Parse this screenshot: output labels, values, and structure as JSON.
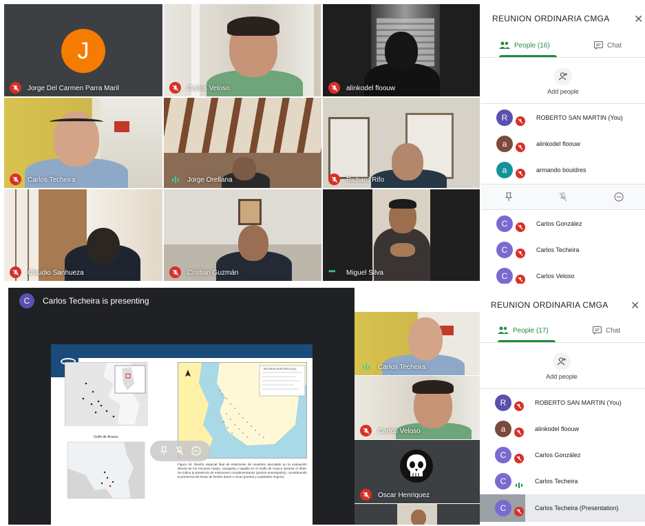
{
  "top": {
    "tiles": [
      {
        "name": "Jorge Del Carmen Parra Maril",
        "initial": "J"
      },
      {
        "name": "Carlos Veloso"
      },
      {
        "name": "alinkodel floouw"
      },
      {
        "name": "Carlos Techeira"
      },
      {
        "name": "Jorge Orellana"
      },
      {
        "name": "Richard Rifo"
      },
      {
        "name": "Claudio Sanhueza"
      },
      {
        "name": "Cristian Guzmán"
      },
      {
        "name": "Miguel Silva"
      }
    ],
    "panel": {
      "title": "REUNION ORDINARIA CMGA",
      "close": "✕",
      "people_tab": "People (16)",
      "chat_tab": "Chat",
      "add_people": "Add people",
      "people": [
        {
          "name": "ROBERTO SAN MARTIN (You)",
          "initial": "R",
          "color": "#5b4fb0"
        },
        {
          "name": "alinkodel floouw",
          "initial": "a",
          "color": "#7b4a3a"
        },
        {
          "name": "armando bouldres",
          "initial": "a",
          "color": "#12939a"
        },
        {
          "name": "Carlos González",
          "initial": "C",
          "color": "#7a6ad0"
        },
        {
          "name": "Carlos Techeira",
          "initial": "C",
          "color": "#7a6ad0"
        },
        {
          "name": "Carlos Veloso",
          "initial": "C",
          "color": "#7a6ad0"
        }
      ]
    }
  },
  "bottom": {
    "presenter_banner": "Carlos Techeira is presenting",
    "presenter_initial": "C",
    "side_tiles": [
      {
        "name": "Carlos Techeira"
      },
      {
        "name": "Carlos Veloso"
      },
      {
        "name": "Oscar Henriquez"
      }
    ],
    "slide": {
      "left_map_title": "Golfo de Arauco",
      "legend_title": "RECURSO MUESTREO (101)",
      "caption": "Figura 19. Diseño espacial final de estaciones de muestreo ejecutado en la evaluación directa de los recursos huepo, navajuela y taquilla en el Golfo de Arauco durante el 2020. Se indica la presencia de estaciones complementarias (puntos anaranjados), considerando la presencia de áreas de fondos duros o rocas (puntos y cuadrados negros)."
    },
    "panel": {
      "title": "REUNION ORDINARIA CMGA",
      "close": "✕",
      "people_tab": "People (17)",
      "chat_tab": "Chat",
      "add_people": "Add people",
      "people": [
        {
          "name": "ROBERTO SAN MARTIN (You)",
          "initial": "R",
          "color": "#5b4fb0"
        },
        {
          "name": "alinkodel floouw",
          "initial": "a",
          "color": "#7b4a3a"
        },
        {
          "name": "Carlos González",
          "initial": "C",
          "color": "#7a6ad0"
        },
        {
          "name": "Carlos Techeira",
          "initial": "C",
          "color": "#7a6ad0"
        },
        {
          "name": "Carlos Techeira (Presentation)",
          "initial": "C",
          "color": "#7a6ad0"
        }
      ]
    }
  }
}
